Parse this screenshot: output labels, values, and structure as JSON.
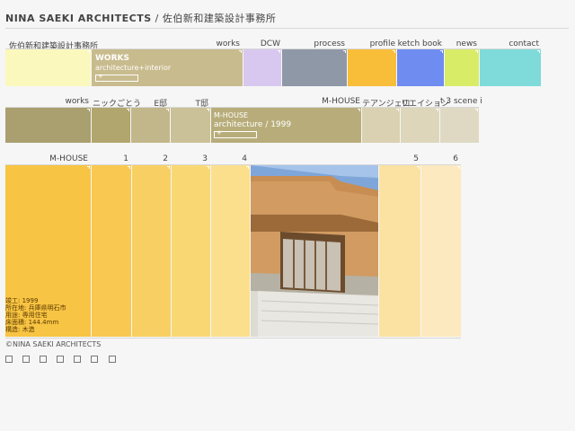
{
  "header": {
    "brand": "NINA SAEKI ARCHITECTS",
    "sub": "/ 佐伯新和建築設計事務所"
  },
  "top_nav": {
    "brand_label": "佐伯新和建築設計事務所",
    "items": [
      {
        "label": "works",
        "color": "#c8bb8d"
      },
      {
        "label": "DCW",
        "color": "#d8c8ef"
      },
      {
        "label": "process",
        "color": "#8f98a7"
      },
      {
        "label": "profile",
        "color": "#f8bd39"
      },
      {
        "label": "ketch book",
        "color": "#6f8cf1"
      },
      {
        "label": "news",
        "color": "#d8ec67"
      },
      {
        "label": "contact",
        "color": "#7edbda"
      }
    ],
    "card": {
      "title": "WORKS",
      "subtitle": "architecture+interior"
    }
  },
  "works_nav": {
    "items": [
      {
        "label": "works",
        "color": "#aa9f6f"
      },
      {
        "label": "ニックごとう",
        "color": "#b2a66f"
      },
      {
        "label": "E邸",
        "color": "#c2b78a"
      },
      {
        "label": "T邸",
        "color": "#cac198"
      },
      {
        "label": "M-HOUSE",
        "color": "#b8ad7a"
      },
      {
        "label": "テアンジェロ",
        "color": "#d9d1b1"
      },
      {
        "label": "リエイション",
        "color": "#ddd6bb"
      },
      {
        "label": "t 3 scene i",
        "color": "#dfd9c3"
      }
    ],
    "card": {
      "title": "M-HOUSE",
      "subtitle": "architecture / 1999"
    }
  },
  "house_nav": {
    "items": [
      {
        "label": "M-HOUSE",
        "color": "#f8c443"
      },
      {
        "label": "1",
        "color": "#f8c850"
      },
      {
        "label": "2",
        "color": "#f8cf62"
      },
      {
        "label": "3",
        "color": "#f9d874"
      },
      {
        "label": "4",
        "color": "#fbdf8d"
      },
      {
        "label": "5",
        "color": "#fbe2a2"
      },
      {
        "label": "6",
        "color": "#fde9bf"
      }
    ],
    "details": [
      "竣工: 1999",
      "所在地: 兵庫県明石市",
      "用途: 専用住宅",
      "床面積: 144.4mm",
      "構造: 木造"
    ]
  },
  "photo": {
    "alt": ""
  },
  "footer": {
    "copyright": "©NINA SAEKI ARCHITECTS"
  },
  "colors": {
    "accent": "#c8bb8d",
    "light_bar": "#fbf8bd",
    "brown": "#aa9f6f",
    "yellow": "#f8c443"
  }
}
